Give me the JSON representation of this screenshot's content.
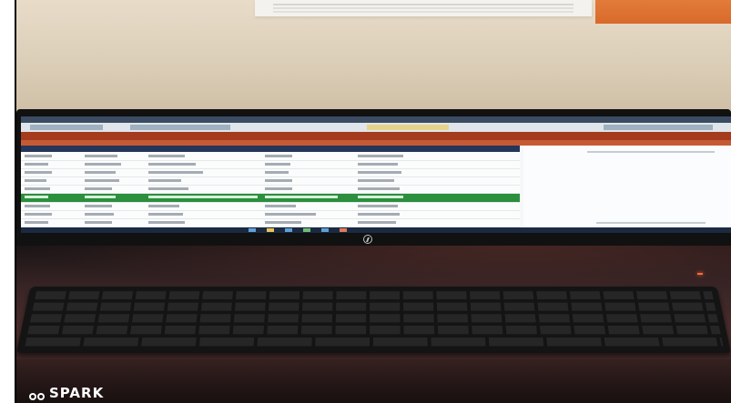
{
  "watermark": {
    "brand": "SPARK",
    "icon": "camera-lens-icon"
  },
  "colors": {
    "selected_row": "#2b8f3d",
    "title_bar": "#a43b1d",
    "header_row": "#26355a",
    "wall": "#ddd0ba",
    "desk": "#3a2526"
  }
}
